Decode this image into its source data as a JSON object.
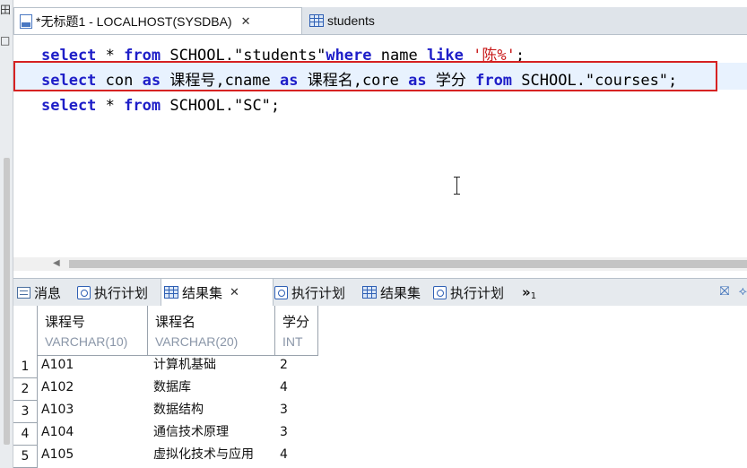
{
  "left_edge": {
    "top_fragment": "田",
    "second_fragment": "□"
  },
  "editor_tabs": [
    {
      "label": "*无标题1 - LOCALHOST(SYSDBA)",
      "close": "✕"
    },
    {
      "label": "students"
    }
  ],
  "code_lines": [
    [
      {
        "t": "select",
        "c": "kw"
      },
      {
        "t": " * ",
        "c": ""
      },
      {
        "t": "from",
        "c": "kw"
      },
      {
        "t": " SCHOOL.\"students\"",
        "c": ""
      },
      {
        "t": "where",
        "c": "kw"
      },
      {
        "t": " name ",
        "c": ""
      },
      {
        "t": "like",
        "c": "kw"
      },
      {
        "t": " ",
        "c": ""
      },
      {
        "t": "'陈%'",
        "c": "str"
      },
      {
        "t": ";",
        "c": ""
      }
    ],
    [
      {
        "t": "select",
        "c": "kw"
      },
      {
        "t": " con ",
        "c": ""
      },
      {
        "t": "as",
        "c": "kw"
      },
      {
        "t": " 课程号,cname ",
        "c": ""
      },
      {
        "t": "as",
        "c": "kw"
      },
      {
        "t": " 课程名,core ",
        "c": ""
      },
      {
        "t": "as",
        "c": "kw"
      },
      {
        "t": " 学分 ",
        "c": ""
      },
      {
        "t": "from",
        "c": "kw"
      },
      {
        "t": " SCHOOL.\"courses\";",
        "c": ""
      }
    ],
    [
      {
        "t": "select",
        "c": "kw"
      },
      {
        "t": " * ",
        "c": ""
      },
      {
        "t": "from",
        "c": "kw"
      },
      {
        "t": " SCHOOL.\"SC\";",
        "c": ""
      }
    ]
  ],
  "result_tabs": [
    {
      "label": "消息",
      "icon": "message-icon"
    },
    {
      "label": "执行计划",
      "icon": "plan-icon"
    },
    {
      "label": "结果集",
      "icon": "grid-icon",
      "close": "✕"
    },
    {
      "label": "执行计划",
      "icon": "plan-icon"
    },
    {
      "label": "结果集",
      "icon": "grid-icon"
    },
    {
      "label": "执行计划",
      "icon": "plan-icon"
    }
  ],
  "overflow": {
    "chevron": "»",
    "count": "1"
  },
  "result_grid": {
    "columns": [
      {
        "name": "课程号",
        "type": "VARCHAR(10)"
      },
      {
        "name": "课程名",
        "type": "VARCHAR(20)"
      },
      {
        "name": "学分",
        "type": "INT"
      }
    ],
    "rows": [
      {
        "num": "1",
        "cells": [
          "A101",
          "计算机基础",
          "2"
        ]
      },
      {
        "num": "2",
        "cells": [
          "A102",
          "数据库",
          "4"
        ]
      },
      {
        "num": "3",
        "cells": [
          "A103",
          "数据结构",
          "3"
        ]
      },
      {
        "num": "4",
        "cells": [
          "A104",
          "通信技术原理",
          "3"
        ]
      },
      {
        "num": "5",
        "cells": [
          "A105",
          "虚拟化技术与应用",
          "4"
        ]
      }
    ]
  },
  "colors": {
    "keyword": "#1e1ec8",
    "string": "#c81818",
    "highlight_border": "#d62222",
    "current_line": "#e8f2fe"
  }
}
